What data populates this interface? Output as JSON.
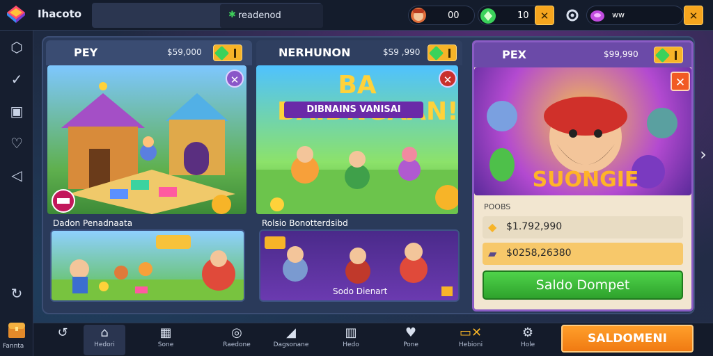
{
  "header": {
    "app_title": "Ihacoto",
    "active_tab": "readenod",
    "resource1_value": "00",
    "resource2_value": "10",
    "resource3_value": "ww"
  },
  "panels": [
    {
      "label": "PEY",
      "price": "$59,000",
      "sub_label": "Dadon Penadnaata"
    },
    {
      "label": "NERHUNON",
      "price": "$S9 ,990",
      "sub_label": "Rolsio Bonotterdsibd",
      "art_title": "BA BAIDNGAAN!",
      "art_subtitle": "DIBNAINS VANISAI",
      "sub_tag": "Sodo Dienart"
    },
    {
      "label": "PEX",
      "price": "$99,990",
      "art_title": "SUONGIE",
      "section_label": "POOBS",
      "stat1": "$1.792,990",
      "stat2": "$0258,26380",
      "button": "Saldo Dompet"
    }
  ],
  "left_rail_label": "Fannta",
  "bottom_nav": [
    {
      "label": "Hedori",
      "icon": "home-icon"
    },
    {
      "label": "Sone",
      "icon": "grid-icon"
    },
    {
      "label": "Raedone",
      "icon": "search-icon"
    },
    {
      "label": "Dagsonane",
      "icon": "tag-icon"
    },
    {
      "label": "Hedo",
      "icon": "gamepad-icon"
    },
    {
      "label": "Pone",
      "icon": "heart-icon"
    },
    {
      "label": "Hebioni",
      "icon": "ticket-icon"
    },
    {
      "label": "Hole",
      "icon": "gear-icon"
    }
  ],
  "cta_label": "SALDOMENI",
  "colors": {
    "accent": "#f6a51e",
    "gem": "#3bd25b",
    "purple": "#6b4aa8",
    "green_button": "#3ab836"
  }
}
